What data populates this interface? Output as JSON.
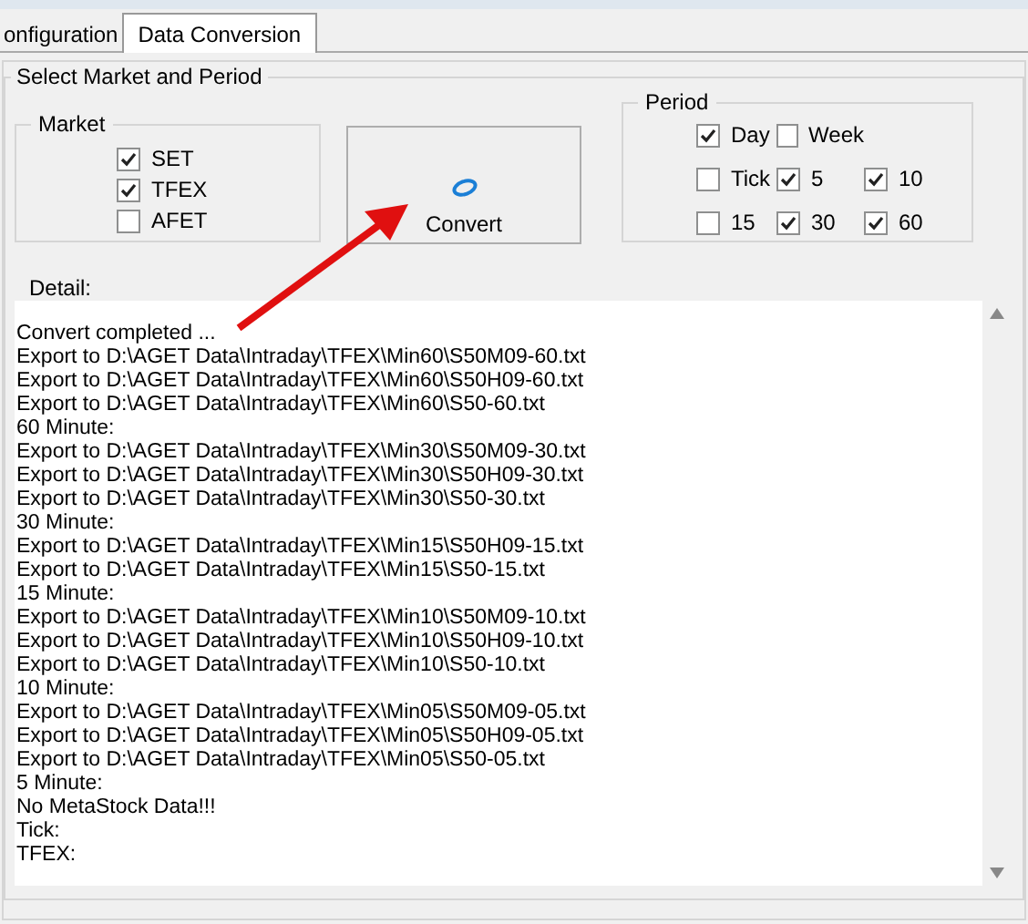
{
  "tabs": [
    {
      "label": "onfiguration",
      "selected": false
    },
    {
      "label": "Data Conversion",
      "selected": true
    }
  ],
  "group_title": "Select Market and Period",
  "market": {
    "title": "Market",
    "items": [
      {
        "label": "SET",
        "checked": true
      },
      {
        "label": "TFEX",
        "checked": true
      },
      {
        "label": "AFET",
        "checked": false
      }
    ]
  },
  "convert_button": {
    "label": "Convert"
  },
  "period": {
    "title": "Period",
    "rows": [
      [
        {
          "label": "Day",
          "checked": true
        },
        {
          "label": "Week",
          "checked": false
        }
      ],
      [
        {
          "label": "Tick",
          "checked": false
        },
        {
          "label": "5",
          "checked": true
        },
        {
          "label": "10",
          "checked": true
        }
      ],
      [
        {
          "label": "15",
          "checked": false
        },
        {
          "label": "30",
          "checked": true
        },
        {
          "label": "60",
          "checked": true
        }
      ]
    ]
  },
  "detail": {
    "label": "Detail:",
    "lines": [
      "Convert completed ...",
      "Export to D:\\AGET Data\\Intraday\\TFEX\\Min60\\S50M09-60.txt",
      "Export to D:\\AGET Data\\Intraday\\TFEX\\Min60\\S50H09-60.txt",
      "Export to D:\\AGET Data\\Intraday\\TFEX\\Min60\\S50-60.txt",
      "60 Minute:",
      "Export to D:\\AGET Data\\Intraday\\TFEX\\Min30\\S50M09-30.txt",
      "Export to D:\\AGET Data\\Intraday\\TFEX\\Min30\\S50H09-30.txt",
      "Export to D:\\AGET Data\\Intraday\\TFEX\\Min30\\S50-30.txt",
      "30 Minute:",
      "Export to D:\\AGET Data\\Intraday\\TFEX\\Min15\\S50H09-15.txt",
      "Export to D:\\AGET Data\\Intraday\\TFEX\\Min15\\S50-15.txt",
      "15 Minute:",
      "Export to D:\\AGET Data\\Intraday\\TFEX\\Min10\\S50M09-10.txt",
      "Export to D:\\AGET Data\\Intraday\\TFEX\\Min10\\S50H09-10.txt",
      "Export to D:\\AGET Data\\Intraday\\TFEX\\Min10\\S50-10.txt",
      "10 Minute:",
      "Export to D:\\AGET Data\\Intraday\\TFEX\\Min05\\S50M09-05.txt",
      "Export to D:\\AGET Data\\Intraday\\TFEX\\Min05\\S50H09-05.txt",
      "Export to D:\\AGET Data\\Intraday\\TFEX\\Min05\\S50-05.txt",
      "5 Minute:",
      "No MetaStock Data!!!",
      "Tick:",
      "TFEX:"
    ]
  }
}
